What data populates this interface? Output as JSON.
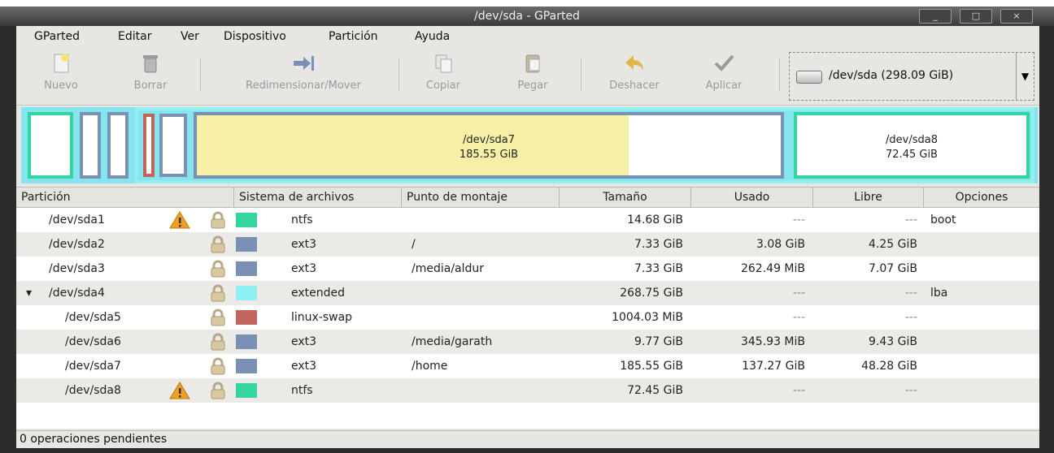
{
  "window": {
    "title": "/dev/sda - GParted"
  },
  "menu": [
    "GParted",
    "Editar",
    "Ver",
    "Dispositivo",
    "Partición",
    "Ayuda"
  ],
  "toolbar": {
    "new": "Nuevo",
    "delete": "Borrar",
    "resize": "Redimensionar/Mover",
    "copy": "Copiar",
    "paste": "Pegar",
    "undo": "Deshacer",
    "apply": "Aplicar"
  },
  "device": {
    "label": "/dev/sda  (298.09 GiB)"
  },
  "map": {
    "sda7": {
      "name": "/dev/sda7",
      "size": "185.55 GiB",
      "used_fraction": 0.74
    },
    "sda8": {
      "name": "/dev/sda8",
      "size": "72.45 GiB"
    }
  },
  "columns": [
    "Partición",
    "Sistema de archivos",
    "Punto de montaje",
    "Tamaño",
    "Usado",
    "Libre",
    "Opciones"
  ],
  "colors": {
    "ntfs": "#33d6a0",
    "ext3": "#7a90b4",
    "extended": "#8ff0f4",
    "linux-swap": "#c0645c"
  },
  "partitions": [
    {
      "name": "/dev/sda1",
      "warning": true,
      "fs": "ntfs",
      "mount": "",
      "size": "14.68 GiB",
      "used": "---",
      "free": "---",
      "flags": "boot"
    },
    {
      "name": "/dev/sda2",
      "warning": false,
      "fs": "ext3",
      "mount": "/",
      "size": "7.33 GiB",
      "used": "3.08 GiB",
      "free": "4.25 GiB",
      "flags": ""
    },
    {
      "name": "/dev/sda3",
      "warning": false,
      "fs": "ext3",
      "mount": "/media/aldur",
      "size": "7.33 GiB",
      "used": "262.49 MiB",
      "free": "7.07 GiB",
      "flags": ""
    },
    {
      "name": "/dev/sda4",
      "warning": false,
      "fs": "extended",
      "mount": "",
      "size": "268.75 GiB",
      "used": "---",
      "free": "---",
      "flags": "lba",
      "expander": "▾"
    },
    {
      "name": "/dev/sda5",
      "warning": false,
      "fs": "linux-swap",
      "mount": "",
      "size": "1004.03 MiB",
      "used": "---",
      "free": "---",
      "flags": ""
    },
    {
      "name": "/dev/sda6",
      "warning": false,
      "fs": "ext3",
      "mount": "/media/garath",
      "size": "9.77 GiB",
      "used": "345.93 MiB",
      "free": "9.43 GiB",
      "flags": ""
    },
    {
      "name": "/dev/sda7",
      "warning": false,
      "fs": "ext3",
      "mount": "/home",
      "size": "185.55 GiB",
      "used": "137.27 GiB",
      "free": "48.28 GiB",
      "flags": ""
    },
    {
      "name": "/dev/sda8",
      "warning": true,
      "fs": "ntfs",
      "mount": "",
      "size": "72.45 GiB",
      "used": "---",
      "free": "---",
      "flags": ""
    }
  ],
  "status": {
    "text": "0 operaciones pendientes"
  }
}
